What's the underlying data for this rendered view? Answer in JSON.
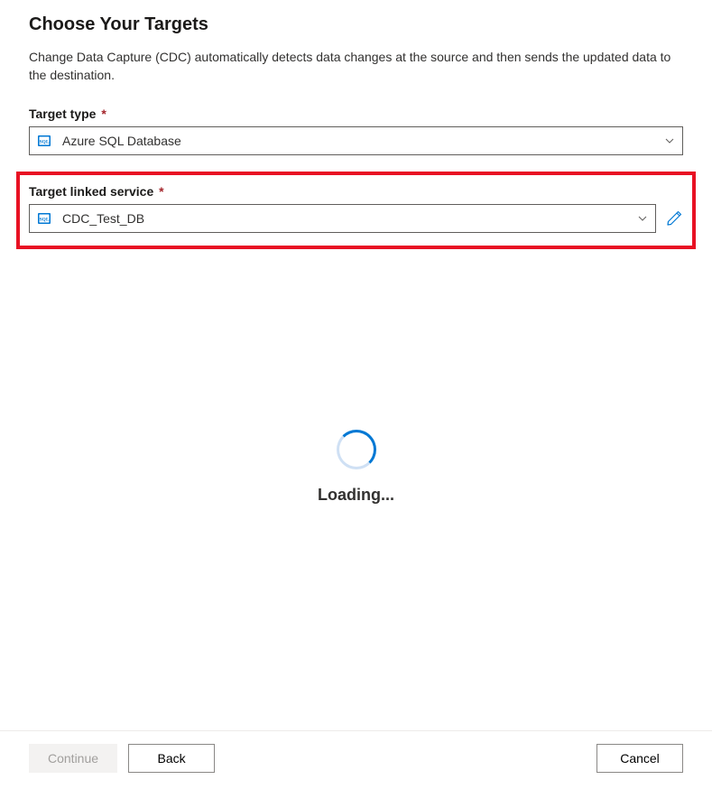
{
  "header": {
    "title": "Choose Your Targets",
    "description": "Change Data Capture (CDC) automatically detects data changes at the source and then sends the updated data to the destination."
  },
  "target_type": {
    "label": "Target type",
    "required_marker": "*",
    "value": "Azure SQL Database",
    "icon": "sql-database-icon"
  },
  "target_linked_service": {
    "label": "Target linked service",
    "required_marker": "*",
    "value": "CDC_Test_DB",
    "icon": "sql-database-icon"
  },
  "loading": {
    "text": "Loading..."
  },
  "footer": {
    "continue_label": "Continue",
    "back_label": "Back",
    "cancel_label": "Cancel"
  }
}
